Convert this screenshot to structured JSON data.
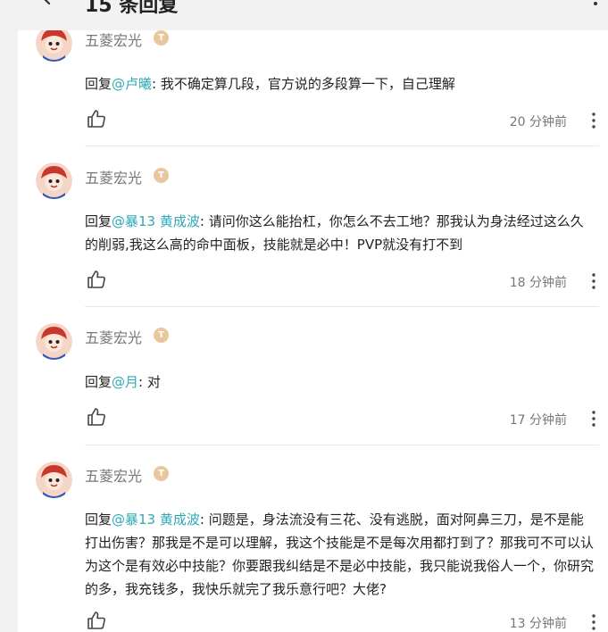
{
  "header": {
    "title": "15 条回复"
  },
  "comments": [
    {
      "username": "五菱宏光",
      "badge": "T",
      "reply_prefix": "回复",
      "mention": "@卢曦",
      "text": ": 我不确定算几段，官方说的多段算一下，自己理解",
      "time": "20 分钟前"
    },
    {
      "username": "五菱宏光",
      "badge": "T",
      "reply_prefix": "回复",
      "mention": "@暴13 黄成波",
      "text": ": 请问你这么能抬杠，你怎么不去工地？那我认为身法经过这么久的削弱,我这么高的命中面板，技能就是必中！PVP就没有打不到",
      "time": "18 分钟前"
    },
    {
      "username": "五菱宏光",
      "badge": "T",
      "reply_prefix": "回复",
      "mention": "@月",
      "text": ": 对",
      "time": "17 分钟前"
    },
    {
      "username": "五菱宏光",
      "badge": "T",
      "reply_prefix": "回复",
      "mention": "@暴13 黄成波",
      "text": ": 问题是，身法流没有三花、没有逃脱，面对阿鼻三刀，是不是能打出伤害？那我是不是可以理解，我这个技能是不是每次用都打到了？那我可不可以认为这个是有效必中技能？你要跟我纠结是不是必中技能，我只能说我俗人一个，你研究的多，我充钱多，我快乐就完了我乐意行吧？大佬?",
      "time": "13 分钟前"
    }
  ],
  "colors": {
    "mention": "#2fa8b8",
    "badge": "#e9c79c",
    "background": "#f2f2f2",
    "panel": "#ffffff"
  },
  "icons": {
    "back": "chevron-left-icon",
    "header_more": "vertical-dots-icon",
    "like": "thumbs-up-icon",
    "comment_more": "vertical-dots-icon"
  }
}
